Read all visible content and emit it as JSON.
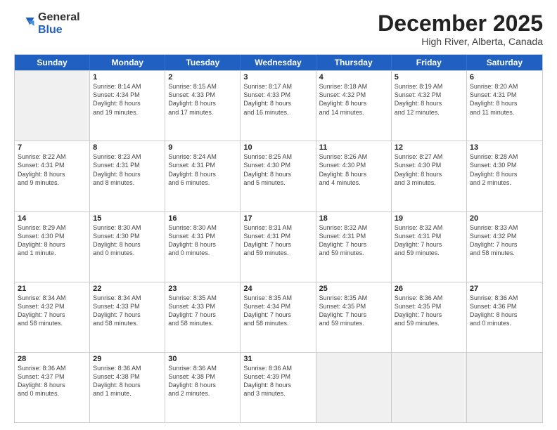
{
  "logo": {
    "line1": "General",
    "line2": "Blue"
  },
  "title": "December 2025",
  "location": "High River, Alberta, Canada",
  "days_of_week": [
    "Sunday",
    "Monday",
    "Tuesday",
    "Wednesday",
    "Thursday",
    "Friday",
    "Saturday"
  ],
  "weeks": [
    [
      {
        "day": "",
        "info": "",
        "shaded": true
      },
      {
        "day": "1",
        "info": "Sunrise: 8:14 AM\nSunset: 4:34 PM\nDaylight: 8 hours\nand 19 minutes."
      },
      {
        "day": "2",
        "info": "Sunrise: 8:15 AM\nSunset: 4:33 PM\nDaylight: 8 hours\nand 17 minutes."
      },
      {
        "day": "3",
        "info": "Sunrise: 8:17 AM\nSunset: 4:33 PM\nDaylight: 8 hours\nand 16 minutes."
      },
      {
        "day": "4",
        "info": "Sunrise: 8:18 AM\nSunset: 4:32 PM\nDaylight: 8 hours\nand 14 minutes."
      },
      {
        "day": "5",
        "info": "Sunrise: 8:19 AM\nSunset: 4:32 PM\nDaylight: 8 hours\nand 12 minutes."
      },
      {
        "day": "6",
        "info": "Sunrise: 8:20 AM\nSunset: 4:31 PM\nDaylight: 8 hours\nand 11 minutes."
      }
    ],
    [
      {
        "day": "7",
        "info": "Sunrise: 8:22 AM\nSunset: 4:31 PM\nDaylight: 8 hours\nand 9 minutes."
      },
      {
        "day": "8",
        "info": "Sunrise: 8:23 AM\nSunset: 4:31 PM\nDaylight: 8 hours\nand 8 minutes."
      },
      {
        "day": "9",
        "info": "Sunrise: 8:24 AM\nSunset: 4:31 PM\nDaylight: 8 hours\nand 6 minutes."
      },
      {
        "day": "10",
        "info": "Sunrise: 8:25 AM\nSunset: 4:30 PM\nDaylight: 8 hours\nand 5 minutes."
      },
      {
        "day": "11",
        "info": "Sunrise: 8:26 AM\nSunset: 4:30 PM\nDaylight: 8 hours\nand 4 minutes."
      },
      {
        "day": "12",
        "info": "Sunrise: 8:27 AM\nSunset: 4:30 PM\nDaylight: 8 hours\nand 3 minutes."
      },
      {
        "day": "13",
        "info": "Sunrise: 8:28 AM\nSunset: 4:30 PM\nDaylight: 8 hours\nand 2 minutes."
      }
    ],
    [
      {
        "day": "14",
        "info": "Sunrise: 8:29 AM\nSunset: 4:30 PM\nDaylight: 8 hours\nand 1 minute."
      },
      {
        "day": "15",
        "info": "Sunrise: 8:30 AM\nSunset: 4:30 PM\nDaylight: 8 hours\nand 0 minutes."
      },
      {
        "day": "16",
        "info": "Sunrise: 8:30 AM\nSunset: 4:31 PM\nDaylight: 8 hours\nand 0 minutes."
      },
      {
        "day": "17",
        "info": "Sunrise: 8:31 AM\nSunset: 4:31 PM\nDaylight: 7 hours\nand 59 minutes."
      },
      {
        "day": "18",
        "info": "Sunrise: 8:32 AM\nSunset: 4:31 PM\nDaylight: 7 hours\nand 59 minutes."
      },
      {
        "day": "19",
        "info": "Sunrise: 8:32 AM\nSunset: 4:31 PM\nDaylight: 7 hours\nand 59 minutes."
      },
      {
        "day": "20",
        "info": "Sunrise: 8:33 AM\nSunset: 4:32 PM\nDaylight: 7 hours\nand 58 minutes."
      }
    ],
    [
      {
        "day": "21",
        "info": "Sunrise: 8:34 AM\nSunset: 4:32 PM\nDaylight: 7 hours\nand 58 minutes."
      },
      {
        "day": "22",
        "info": "Sunrise: 8:34 AM\nSunset: 4:33 PM\nDaylight: 7 hours\nand 58 minutes."
      },
      {
        "day": "23",
        "info": "Sunrise: 8:35 AM\nSunset: 4:33 PM\nDaylight: 7 hours\nand 58 minutes."
      },
      {
        "day": "24",
        "info": "Sunrise: 8:35 AM\nSunset: 4:34 PM\nDaylight: 7 hours\nand 58 minutes."
      },
      {
        "day": "25",
        "info": "Sunrise: 8:35 AM\nSunset: 4:35 PM\nDaylight: 7 hours\nand 59 minutes."
      },
      {
        "day": "26",
        "info": "Sunrise: 8:36 AM\nSunset: 4:35 PM\nDaylight: 7 hours\nand 59 minutes."
      },
      {
        "day": "27",
        "info": "Sunrise: 8:36 AM\nSunset: 4:36 PM\nDaylight: 8 hours\nand 0 minutes."
      }
    ],
    [
      {
        "day": "28",
        "info": "Sunrise: 8:36 AM\nSunset: 4:37 PM\nDaylight: 8 hours\nand 0 minutes."
      },
      {
        "day": "29",
        "info": "Sunrise: 8:36 AM\nSunset: 4:38 PM\nDaylight: 8 hours\nand 1 minute."
      },
      {
        "day": "30",
        "info": "Sunrise: 8:36 AM\nSunset: 4:38 PM\nDaylight: 8 hours\nand 2 minutes."
      },
      {
        "day": "31",
        "info": "Sunrise: 8:36 AM\nSunset: 4:39 PM\nDaylight: 8 hours\nand 3 minutes."
      },
      {
        "day": "",
        "info": "",
        "shaded": true
      },
      {
        "day": "",
        "info": "",
        "shaded": true
      },
      {
        "day": "",
        "info": "",
        "shaded": true
      }
    ]
  ]
}
